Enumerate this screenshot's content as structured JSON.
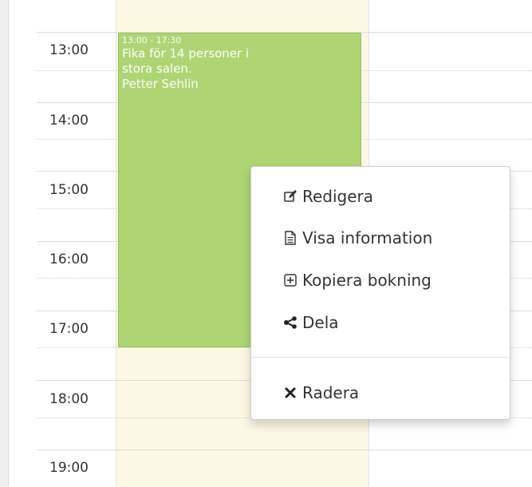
{
  "calendar": {
    "hours": [
      "13:00",
      "14:00",
      "15:00",
      "16:00",
      "17:00",
      "18:00",
      "19:00"
    ]
  },
  "event": {
    "time": "13:00 - 17:30",
    "line1": "Fika för 14 personer i",
    "line2": "stora salen.",
    "line3": "Petter Sehlin",
    "color": "#a9d46f"
  },
  "context_menu": {
    "items": [
      {
        "label": "Redigera",
        "icon": "edit-icon"
      },
      {
        "label": "Visa information",
        "icon": "file-text-icon"
      },
      {
        "label": "Kopiera bokning",
        "icon": "plus-square-icon"
      },
      {
        "label": "Dela",
        "icon": "share-icon"
      },
      {
        "label": "Radera",
        "icon": "close-icon"
      }
    ]
  }
}
